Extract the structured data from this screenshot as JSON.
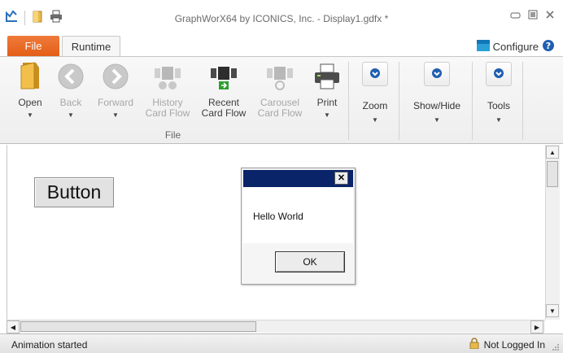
{
  "window": {
    "title": "GraphWorX64 by ICONICS, Inc. - Display1.gdfx *",
    "controls": [
      "minimize-icon",
      "restore-icon",
      "close-icon"
    ]
  },
  "quick_access": [
    "pointer-icon",
    "folder-icon",
    "print-icon"
  ],
  "tabs": [
    {
      "label": "File",
      "color": "#e8631f"
    },
    {
      "label": "Runtime"
    }
  ],
  "configure": {
    "label": "Configure",
    "help": "?"
  },
  "ribbon": {
    "file_group": {
      "label": "File",
      "buttons": [
        {
          "line1": "Open",
          "line2": "",
          "icon": "folder-icon",
          "enabled": true,
          "dropdown": true
        },
        {
          "line1": "Back",
          "line2": "",
          "icon": "back-arrow-icon",
          "enabled": false,
          "dropdown": true
        },
        {
          "line1": "Forward",
          "line2": "",
          "icon": "forward-arrow-icon",
          "enabled": false,
          "dropdown": true
        },
        {
          "line1": "History",
          "line2": "Card Flow",
          "icon": "history-card-flow-icon",
          "enabled": false
        },
        {
          "line1": "Recent",
          "line2": "Card Flow",
          "icon": "recent-card-flow-icon",
          "enabled": true
        },
        {
          "line1": "Carousel",
          "line2": "Card Flow",
          "icon": "carousel-card-flow-icon",
          "enabled": false
        },
        {
          "line1": "Print",
          "line2": "",
          "icon": "printer-icon",
          "enabled": true,
          "dropdown": true
        }
      ]
    },
    "groups": [
      {
        "label": "Zoom",
        "icon": "zoom-icon"
      },
      {
        "label": "Show/Hide",
        "icon": "show-hide-icon"
      },
      {
        "label": "Tools",
        "icon": "tools-icon"
      }
    ]
  },
  "canvas": {
    "button_label": "Button"
  },
  "dialog": {
    "message": "Hello World",
    "ok_label": "OK",
    "title_color": "#0a246a"
  },
  "status": {
    "left": "Animation started",
    "right": "Not Logged In"
  }
}
